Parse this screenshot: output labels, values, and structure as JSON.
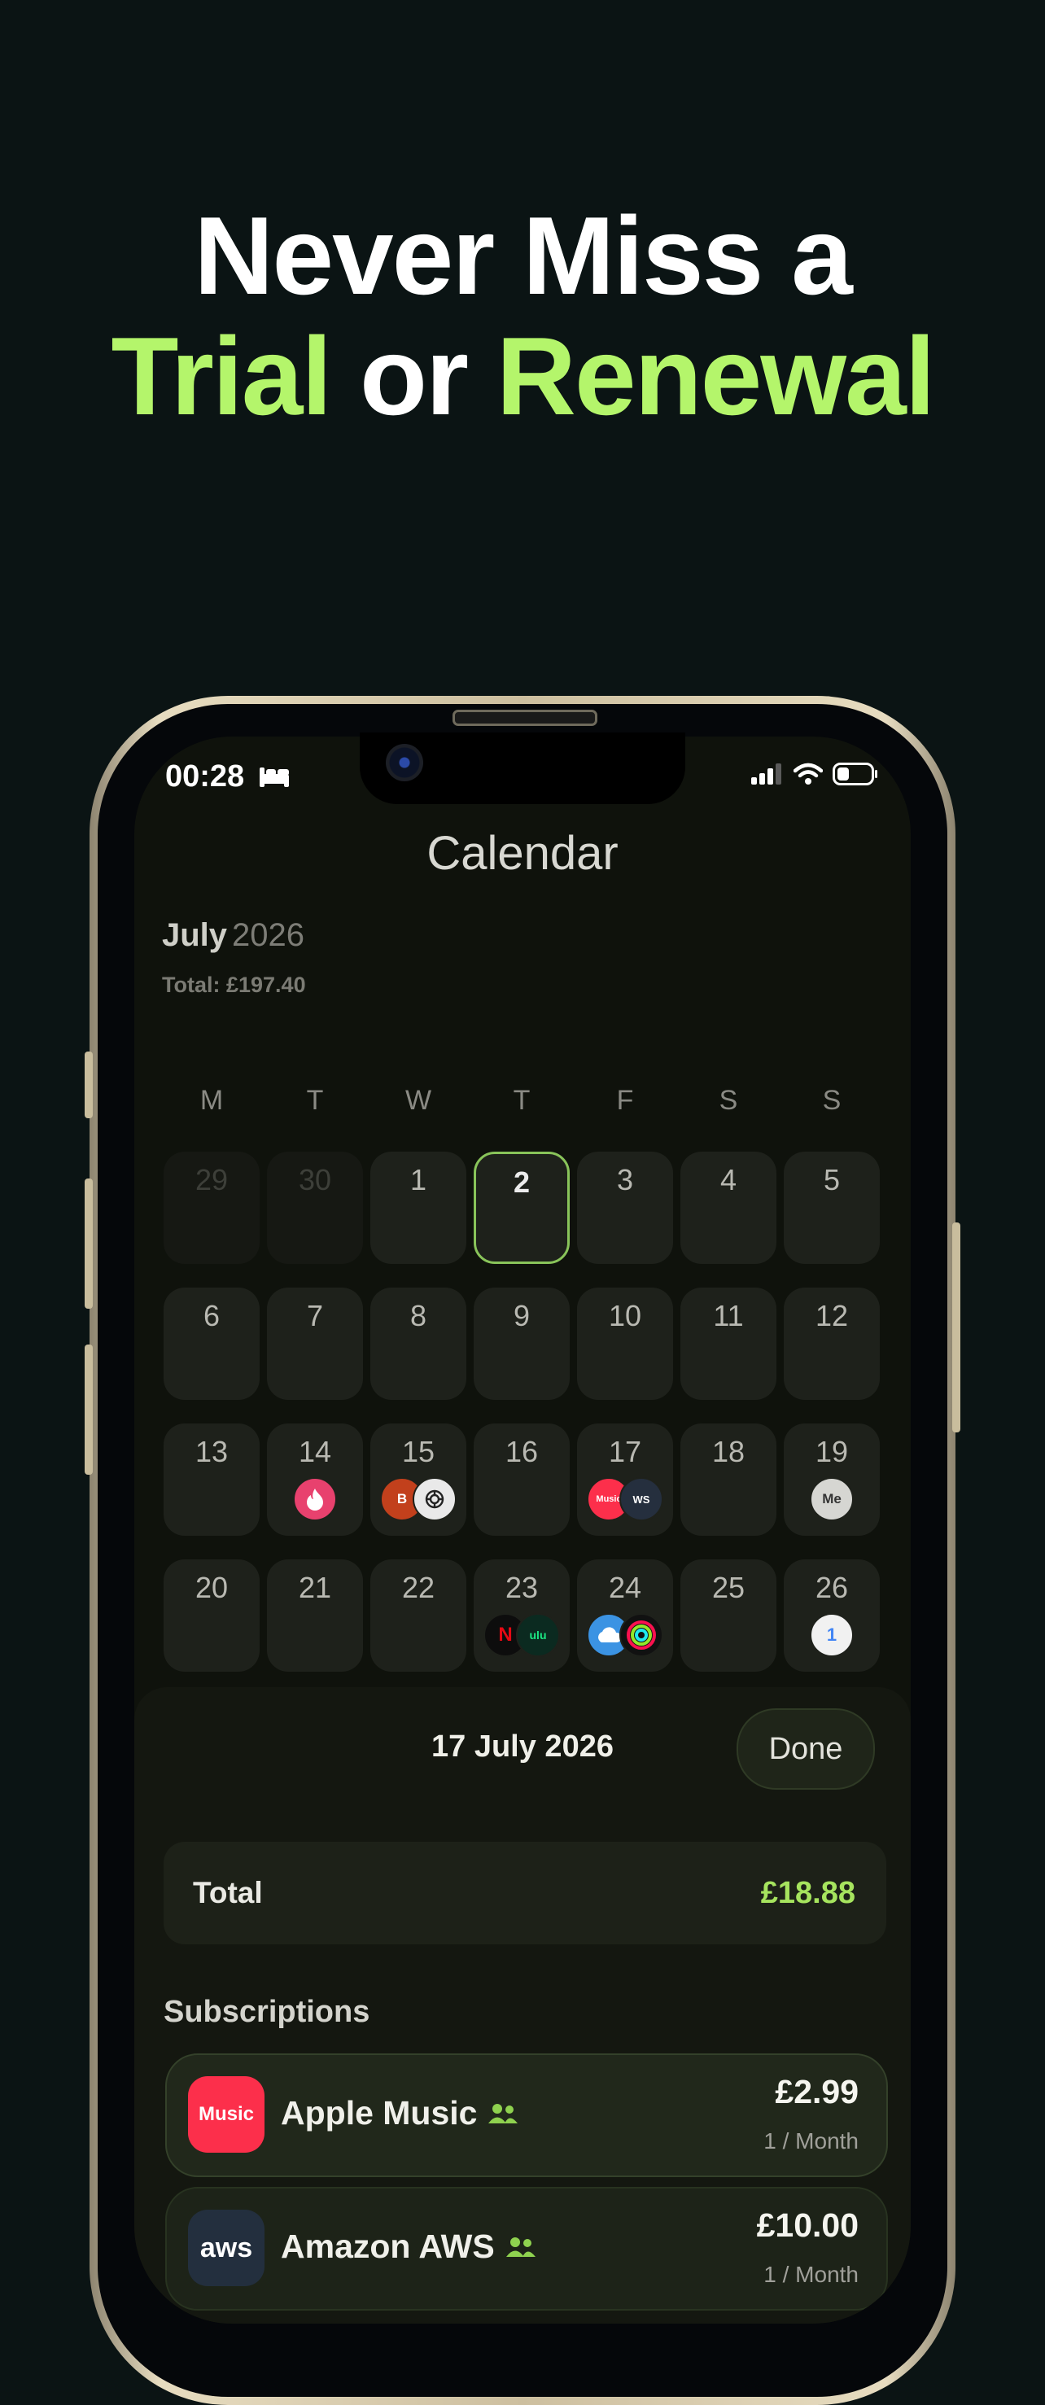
{
  "headline": {
    "line1": "Never Miss a",
    "word_trial": "Trial",
    "word_or": "or",
    "word_renewal": "Renewal"
  },
  "status_bar": {
    "time": "00:28",
    "icons": [
      "bed-icon",
      "signal-icon",
      "wifi-icon",
      "battery-icon"
    ]
  },
  "calendar": {
    "title": "Calendar",
    "month": "July",
    "year": "2026",
    "total": "Total: £197.40",
    "weekdays": [
      "M",
      "T",
      "W",
      "T",
      "F",
      "S",
      "S"
    ],
    "selected_day": "2",
    "weeks": [
      [
        {
          "d": "29",
          "muted": true
        },
        {
          "d": "30",
          "muted": true
        },
        {
          "d": "1"
        },
        {
          "d": "2",
          "today": true
        },
        {
          "d": "3"
        },
        {
          "d": "4"
        },
        {
          "d": "5"
        }
      ],
      [
        {
          "d": "6"
        },
        {
          "d": "7"
        },
        {
          "d": "8"
        },
        {
          "d": "9"
        },
        {
          "d": "10"
        },
        {
          "d": "11"
        },
        {
          "d": "12"
        }
      ],
      [
        {
          "d": "13"
        },
        {
          "d": "14",
          "logos": [
            "tinder"
          ]
        },
        {
          "d": "15",
          "logos": [
            "b-badge",
            "openai"
          ]
        },
        {
          "d": "16"
        },
        {
          "d": "17",
          "logos": [
            "apple-music",
            "aws"
          ]
        },
        {
          "d": "18"
        },
        {
          "d": "19",
          "logos": [
            "me"
          ]
        }
      ],
      [
        {
          "d": "20"
        },
        {
          "d": "21"
        },
        {
          "d": "22"
        },
        {
          "d": "23",
          "logos": [
            "netflix",
            "hulu"
          ]
        },
        {
          "d": "24",
          "logos": [
            "icloud",
            "fitness"
          ]
        },
        {
          "d": "25"
        },
        {
          "d": "26",
          "logos": [
            "google-one"
          ]
        }
      ]
    ],
    "logo_text": {
      "b-badge": "B",
      "me": "Me",
      "netflix": "N",
      "hulu": "ulu",
      "apple-music": "Music",
      "aws": "WS",
      "google-one": "1"
    }
  },
  "sheet": {
    "date": "17 July 2026",
    "done_label": "Done",
    "total_label": "Total",
    "total_value": "£18.88",
    "subscriptions_label": "Subscriptions",
    "subscriptions": [
      {
        "name": "Apple Music",
        "price": "£2.99",
        "period": "1 / Month",
        "logo_text": "Music",
        "shared": true
      },
      {
        "name": "Amazon AWS",
        "price": "£10.00",
        "period": "1 / Month",
        "logo_text": "aws",
        "shared": true
      }
    ]
  },
  "colors": {
    "accent": "#b4f56b",
    "background": "#0b1414",
    "today_border": "#89c45a",
    "total_value": "#a6e45e"
  }
}
